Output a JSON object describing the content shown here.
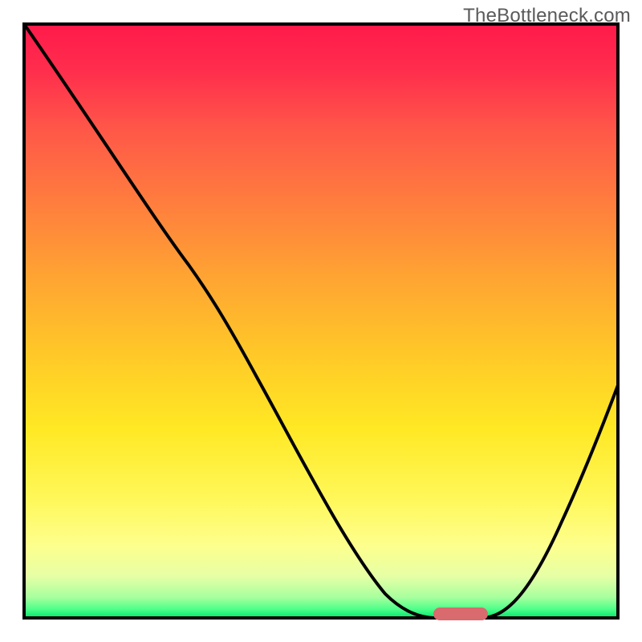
{
  "watermark": "TheBottleneck.com",
  "colors": {
    "gradient_top": "#ff1a4a",
    "gradient_mid_orange": "#ffa233",
    "gradient_mid_yellow": "#ffe824",
    "gradient_bottom_green": "#00e56b",
    "curve": "#000000",
    "frame": "#000000",
    "optimal_marker": "#d96a6e"
  },
  "chart_data": {
    "type": "line",
    "title": "",
    "xlabel": "",
    "ylabel": "",
    "xlim": [
      0,
      100
    ],
    "ylim": [
      0,
      100
    ],
    "grid": false,
    "legend": false,
    "x": [
      0,
      5,
      10,
      15,
      20,
      25,
      28,
      35,
      45,
      55,
      61,
      65,
      69,
      73,
      77,
      83,
      90,
      95,
      100
    ],
    "values": [
      100,
      88,
      78,
      70,
      63,
      57,
      54,
      45,
      33,
      20,
      8,
      2,
      0,
      0,
      0,
      2,
      16,
      30,
      40
    ],
    "optimal_range_x": [
      69,
      77
    ],
    "notes": "y is bottleneck percentage (100 at top = severe, 0 at bottom = none); background hue encodes same scale (red=bad, green=good); pink bar marks optimal x-range where bottleneck ≈ 0"
  }
}
